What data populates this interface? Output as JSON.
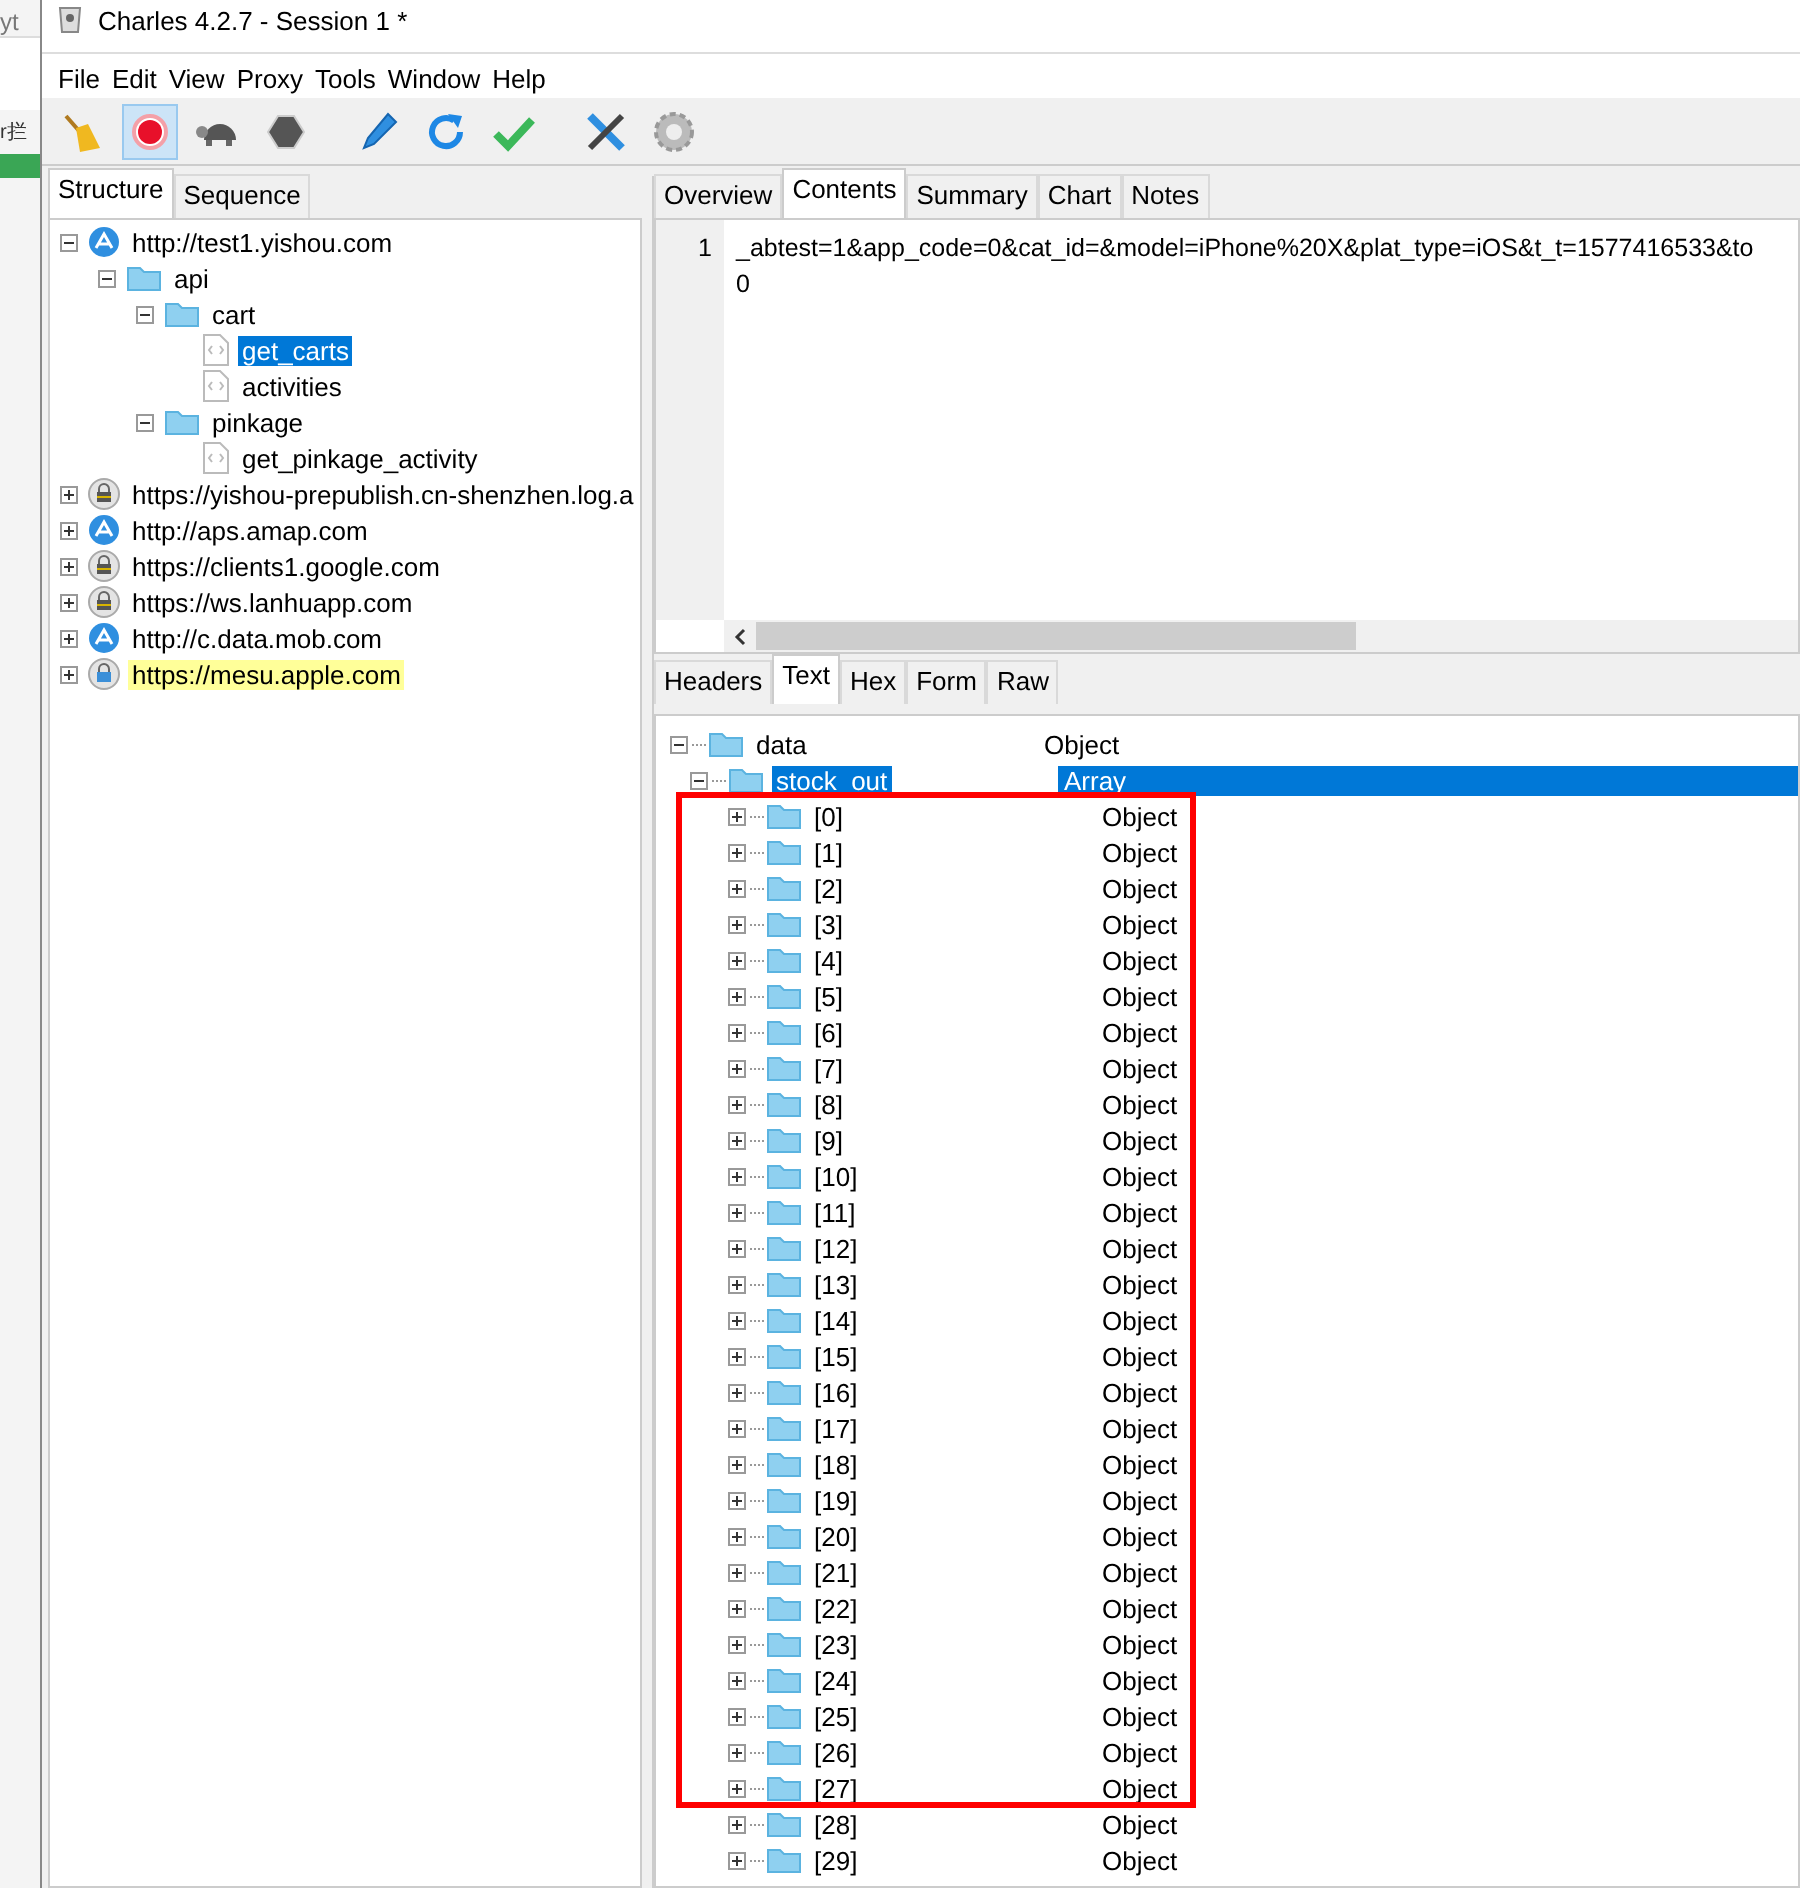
{
  "behind_window": {
    "texts": [
      "yt",
      "r拦"
    ]
  },
  "window": {
    "title": "Charles 4.2.7 - Session 1 *"
  },
  "menu": [
    "File",
    "Edit",
    "View",
    "Proxy",
    "Tools",
    "Window",
    "Help"
  ],
  "toolbar": [
    {
      "kind": "broom",
      "selected": false
    },
    {
      "kind": "record",
      "selected": true
    },
    {
      "kind": "turtle",
      "selected": false
    },
    {
      "kind": "stop",
      "selected": false
    },
    {
      "kind": "pen",
      "selected": false
    },
    {
      "kind": "refresh",
      "selected": false
    },
    {
      "kind": "check",
      "selected": false
    },
    {
      "kind": "tools",
      "selected": false
    },
    {
      "kind": "gear",
      "selected": false
    }
  ],
  "left_tabs": [
    {
      "label": "Structure",
      "selected": true
    },
    {
      "label": "Sequence",
      "selected": false
    }
  ],
  "structure": [
    {
      "label": "http://test1.yishou.com",
      "kind": "globe",
      "expanded": true,
      "children": [
        {
          "label": "api",
          "kind": "folder",
          "expanded": true,
          "children": [
            {
              "label": "cart",
              "kind": "folder",
              "expanded": true,
              "children": [
                {
                  "label": "get_carts",
                  "kind": "file",
                  "selected": true,
                  "highlighted": false
                },
                {
                  "label": "activities",
                  "kind": "file",
                  "selected": false,
                  "highlighted": false
                }
              ]
            },
            {
              "label": "pinkage",
              "kind": "folder",
              "expanded": true,
              "children": [
                {
                  "label": "get_pinkage_activity",
                  "kind": "file",
                  "selected": false,
                  "highlighted": false
                }
              ]
            }
          ]
        }
      ]
    },
    {
      "label": "https://yishou-prepublish.cn-shenzhen.log.a",
      "kind": "lock",
      "expanded": false
    },
    {
      "label": "http://aps.amap.com",
      "kind": "globe",
      "expanded": false
    },
    {
      "label": "https://clients1.google.com",
      "kind": "lock",
      "expanded": false
    },
    {
      "label": "https://ws.lanhuapp.com",
      "kind": "lock",
      "expanded": false
    },
    {
      "label": "http://c.data.mob.com",
      "kind": "globe",
      "expanded": false
    },
    {
      "label": "https://mesu.apple.com",
      "kind": "lock-blue",
      "expanded": false,
      "highlighted": true
    }
  ],
  "right_tabs": [
    {
      "label": "Overview",
      "selected": false
    },
    {
      "label": "Contents",
      "selected": true
    },
    {
      "label": "Summary",
      "selected": false
    },
    {
      "label": "Chart",
      "selected": false
    },
    {
      "label": "Notes",
      "selected": false
    }
  ],
  "request_body": {
    "line_numbers": [
      "1"
    ],
    "lines": [
      "_abtest=1&app_code=0&cat_id=&model=iPhone%20X&plat_type=iOS&t_t=1577416533&to",
      "0"
    ]
  },
  "response_tabs": [
    {
      "label": "Headers",
      "selected": false
    },
    {
      "label": "Text",
      "selected": true
    },
    {
      "label": "Hex",
      "selected": false
    },
    {
      "label": "Form",
      "selected": false
    },
    {
      "label": "Raw",
      "selected": false
    }
  ],
  "response_tree": [
    {
      "name": "data",
      "type": "Object",
      "expanded": true,
      "selected": false,
      "children": [
        {
          "name": "stock_out",
          "type": "Array",
          "expanded": true,
          "selected": true,
          "children": [
            {
              "name": "[0]",
              "type": "Object",
              "expanded": false,
              "selected": false
            },
            {
              "name": "[1]",
              "type": "Object",
              "expanded": false,
              "selected": false
            },
            {
              "name": "[2]",
              "type": "Object",
              "expanded": false,
              "selected": false
            },
            {
              "name": "[3]",
              "type": "Object",
              "expanded": false,
              "selected": false
            },
            {
              "name": "[4]",
              "type": "Object",
              "expanded": false,
              "selected": false
            },
            {
              "name": "[5]",
              "type": "Object",
              "expanded": false,
              "selected": false
            },
            {
              "name": "[6]",
              "type": "Object",
              "expanded": false,
              "selected": false
            },
            {
              "name": "[7]",
              "type": "Object",
              "expanded": false,
              "selected": false
            },
            {
              "name": "[8]",
              "type": "Object",
              "expanded": false,
              "selected": false
            },
            {
              "name": "[9]",
              "type": "Object",
              "expanded": false,
              "selected": false
            },
            {
              "name": "[10]",
              "type": "Object",
              "expanded": false,
              "selected": false
            },
            {
              "name": "[11]",
              "type": "Object",
              "expanded": false,
              "selected": false
            },
            {
              "name": "[12]",
              "type": "Object",
              "expanded": false,
              "selected": false
            },
            {
              "name": "[13]",
              "type": "Object",
              "expanded": false,
              "selected": false
            },
            {
              "name": "[14]",
              "type": "Object",
              "expanded": false,
              "selected": false
            },
            {
              "name": "[15]",
              "type": "Object",
              "expanded": false,
              "selected": false
            },
            {
              "name": "[16]",
              "type": "Object",
              "expanded": false,
              "selected": false
            },
            {
              "name": "[17]",
              "type": "Object",
              "expanded": false,
              "selected": false
            },
            {
              "name": "[18]",
              "type": "Object",
              "expanded": false,
              "selected": false
            },
            {
              "name": "[19]",
              "type": "Object",
              "expanded": false,
              "selected": false
            },
            {
              "name": "[20]",
              "type": "Object",
              "expanded": false,
              "selected": false
            },
            {
              "name": "[21]",
              "type": "Object",
              "expanded": false,
              "selected": false
            },
            {
              "name": "[22]",
              "type": "Object",
              "expanded": false,
              "selected": false
            },
            {
              "name": "[23]",
              "type": "Object",
              "expanded": false,
              "selected": false
            },
            {
              "name": "[24]",
              "type": "Object",
              "expanded": false,
              "selected": false
            },
            {
              "name": "[25]",
              "type": "Object",
              "expanded": false,
              "selected": false
            },
            {
              "name": "[26]",
              "type": "Object",
              "expanded": false,
              "selected": false
            },
            {
              "name": "[27]",
              "type": "Object",
              "expanded": false,
              "selected": false
            },
            {
              "name": "[28]",
              "type": "Object",
              "expanded": false,
              "selected": false
            },
            {
              "name": "[29]",
              "type": "Object",
              "expanded": false,
              "selected": false
            }
          ]
        }
      ]
    }
  ]
}
